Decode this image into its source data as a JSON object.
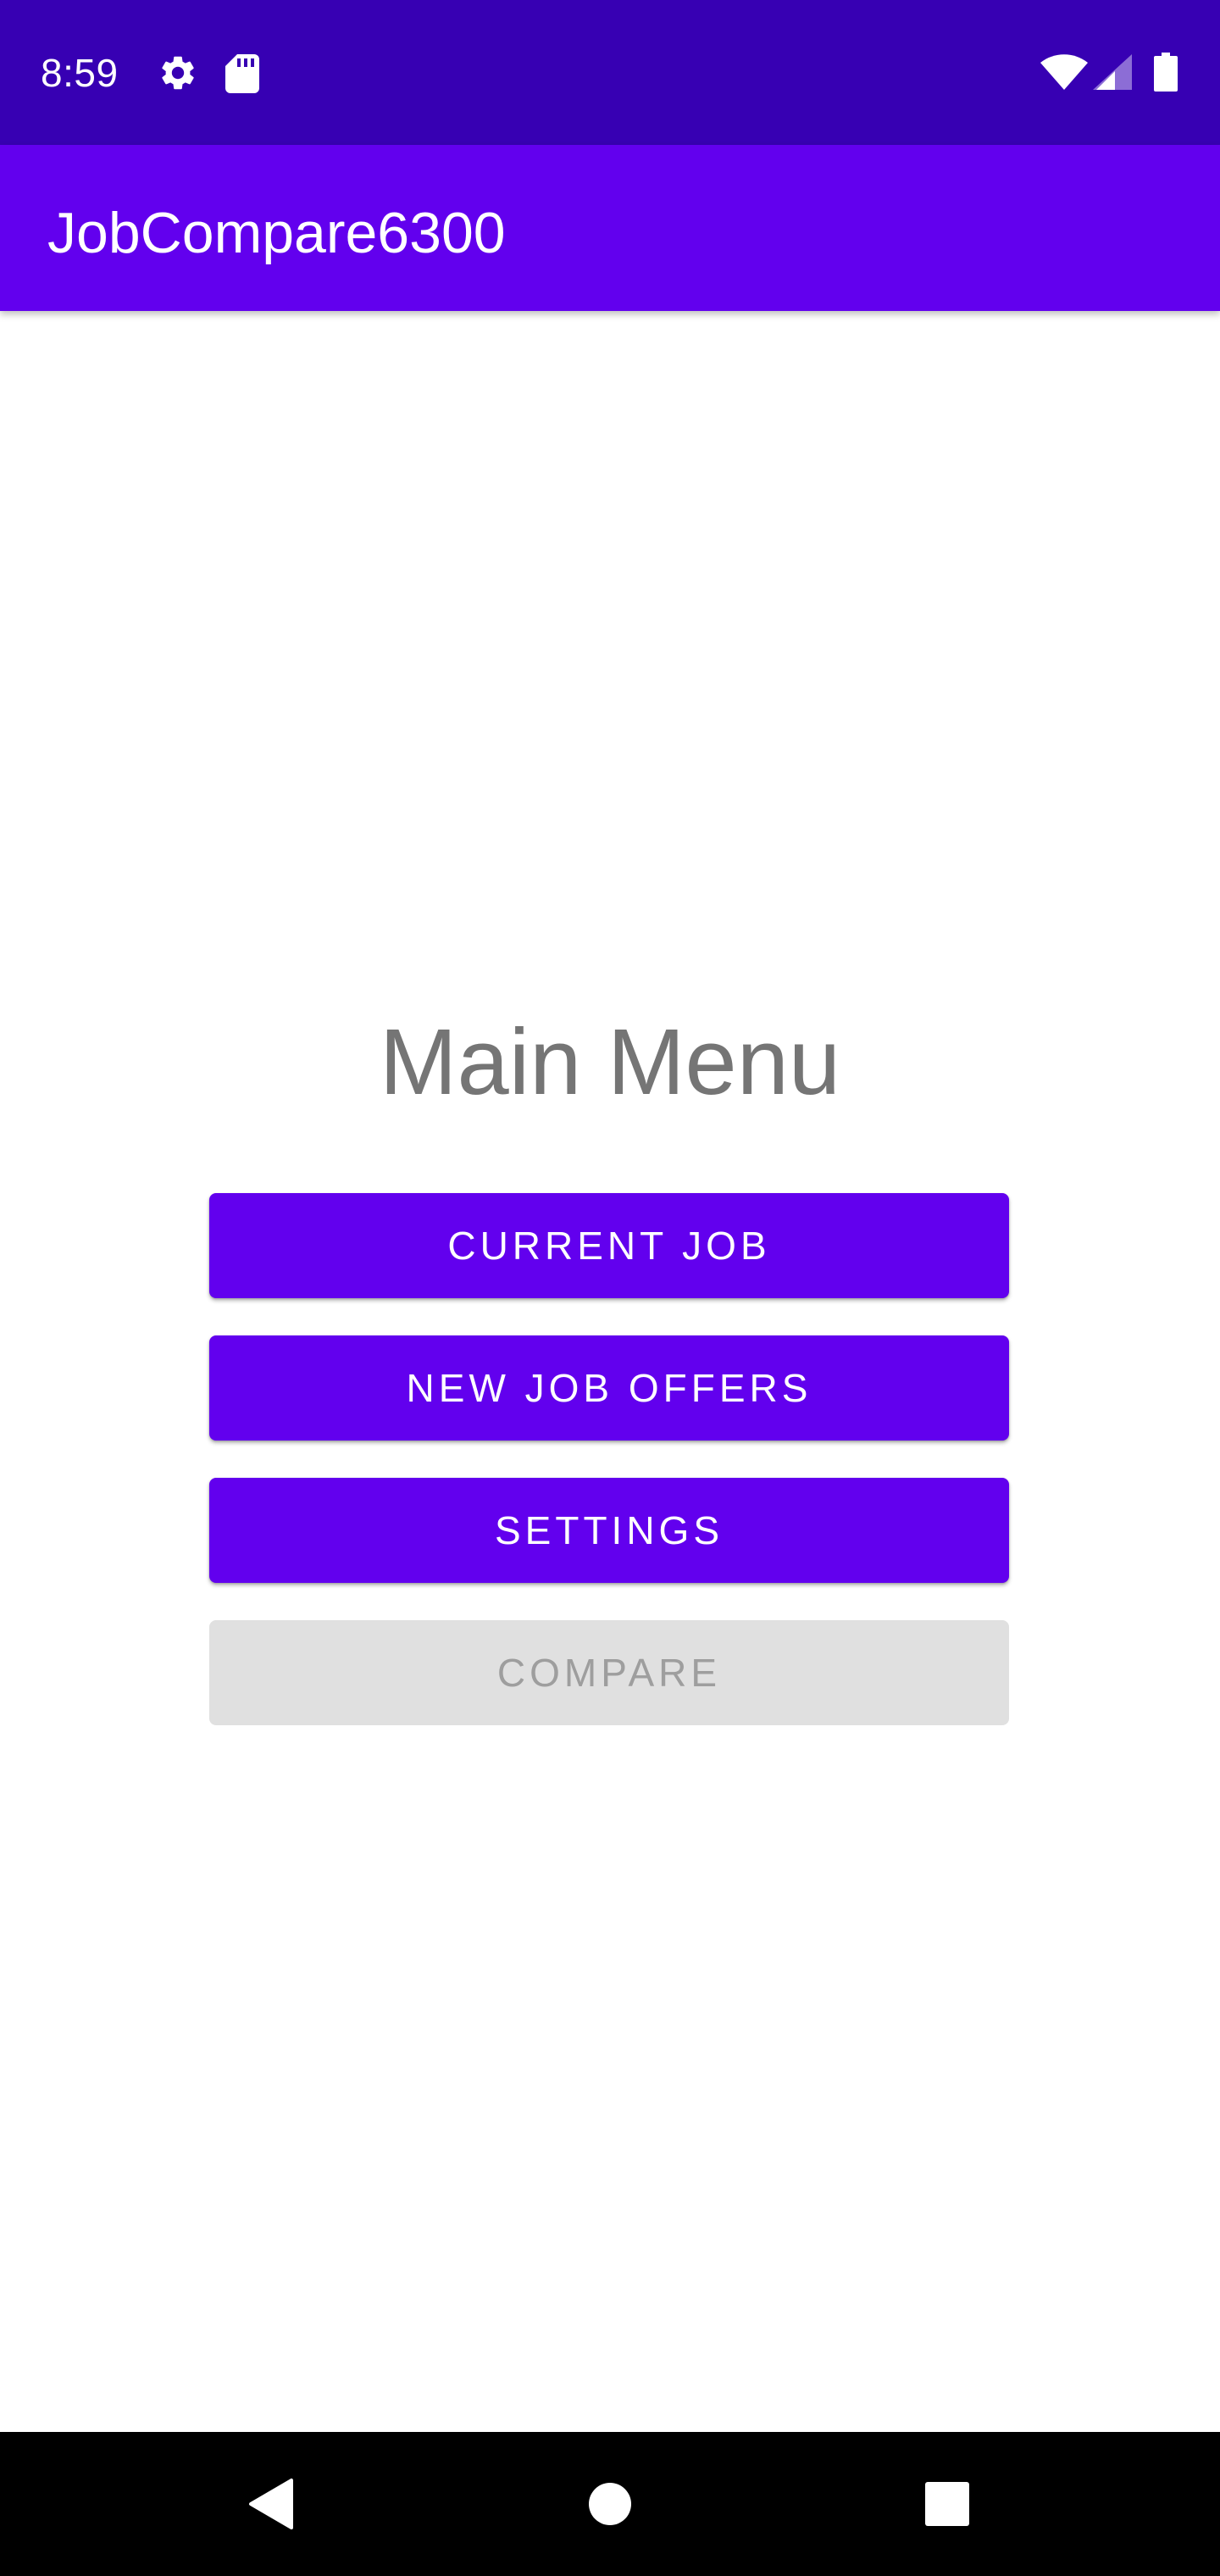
{
  "status_bar": {
    "time": "8:59",
    "icons": [
      "gear-icon",
      "sd-card-icon",
      "wifi-icon",
      "signal-icon",
      "battery-icon"
    ],
    "background": "#3700B3"
  },
  "app_bar": {
    "title": "JobCompare6300",
    "background": "#6200EE"
  },
  "main": {
    "title": "Main Menu",
    "buttons": [
      {
        "label": "CURRENT JOB",
        "enabled": true
      },
      {
        "label": "NEW JOB OFFERS",
        "enabled": true
      },
      {
        "label": "SETTINGS",
        "enabled": true
      },
      {
        "label": "COMPARE",
        "enabled": false
      }
    ]
  },
  "colors": {
    "accent": "#6200EE",
    "accent_dark": "#3700B3",
    "disabled_bg": "#E0E0E0",
    "disabled_text": "#9E9E9E",
    "title_text": "#757575"
  },
  "nav_bar": {
    "icons": [
      "back-icon",
      "home-icon",
      "recents-icon"
    ]
  }
}
